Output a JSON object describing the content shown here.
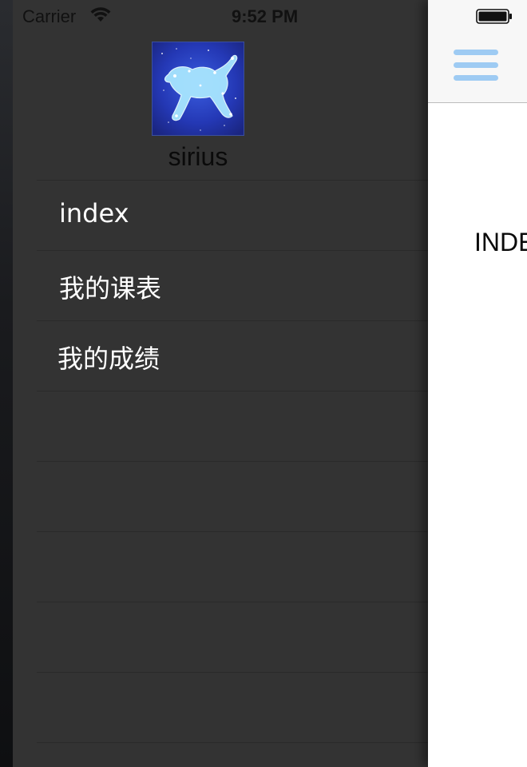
{
  "status_bar": {
    "carrier": "Carrier",
    "time": "9:52 PM",
    "wifi_icon": "wifi-icon",
    "battery_icon": "battery-icon"
  },
  "drawer": {
    "avatar_icon": "constellation-lion-avatar",
    "username": "sirius",
    "menu_items": [
      {
        "label": "index"
      },
      {
        "label": "我的课表"
      },
      {
        "label": "我的成绩"
      },
      {
        "label": ""
      },
      {
        "label": ""
      },
      {
        "label": ""
      },
      {
        "label": ""
      },
      {
        "label": ""
      }
    ]
  },
  "content": {
    "menu_button_icon": "hamburger-menu-icon",
    "title": "INDEX"
  },
  "colors": {
    "drawer_bg": "#333333",
    "menu_text": "#ffffff",
    "accent": "#9ecbf3",
    "nav_bg": "#f7f7f7"
  }
}
